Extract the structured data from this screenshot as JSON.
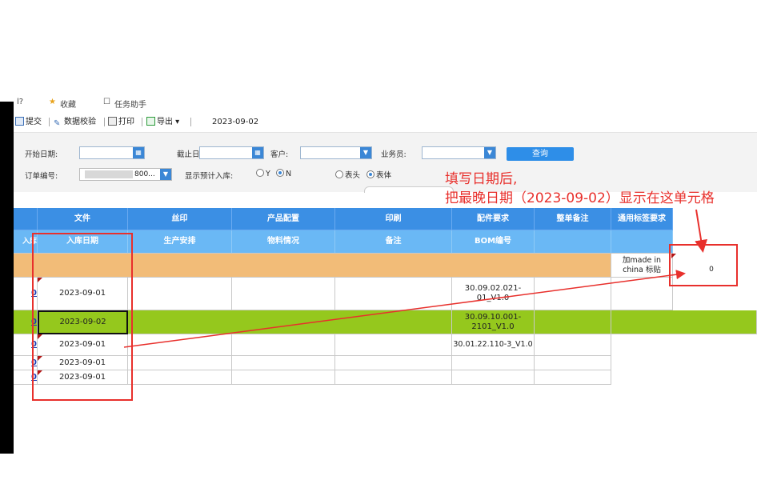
{
  "topstrip": {
    "item1": "收藏",
    "item2": "任务助手"
  },
  "toolbar": {
    "submit": "提交",
    "validate": "数据校验",
    "print": "打印",
    "export": "导出 ▾",
    "date": "2023-09-02"
  },
  "filters": {
    "start_date_label": "开始日期:",
    "end_date_label": "截止日期:",
    "customer_label": "客户:",
    "salesperson_label": "业务员:",
    "query_button": "查询",
    "order_no_label": "订单编号:",
    "order_no_value": "800...",
    "show_expected_label": "显示预计入库:",
    "option_y": "Y",
    "option_n": "N",
    "option_header": "表头",
    "option_body": "表体"
  },
  "table": {
    "header1": [
      "文件",
      "丝印",
      "产品配置",
      "印刷",
      "配件要求",
      "整单备注",
      "通用标签要求"
    ],
    "header2": [
      "入库日期",
      "生产安排",
      "物料情况",
      "备注",
      "BOM编号"
    ],
    "left_header": "入库",
    "orange_row_label": "加made in china 标贴",
    "highlight_value": "0",
    "rows": [
      {
        "link": "0",
        "date": "2023-09-01",
        "bom": "30.09.02.021-01_V1.0"
      },
      {
        "link": "0",
        "date": "2023-09-02",
        "bom": "30.09.10.001-2101_V1.0"
      },
      {
        "link": "0",
        "date": "2023-09-01",
        "bom": "30.01.22.110-3_V1.0"
      },
      {
        "link": "0",
        "date": "2023-09-01",
        "bom": ""
      },
      {
        "link": "0",
        "date": "2023-09-01",
        "bom": ""
      }
    ]
  },
  "annotation": {
    "line1": "填写日期后,",
    "line2": "把最晚日期（2023-09-02）显示在这单元格"
  },
  "colors": {
    "header": "#3b8fe4",
    "subheader": "#6ab8f5",
    "orange": "#f2bc78",
    "green": "#95c81d",
    "annotation": "#e8302c"
  }
}
